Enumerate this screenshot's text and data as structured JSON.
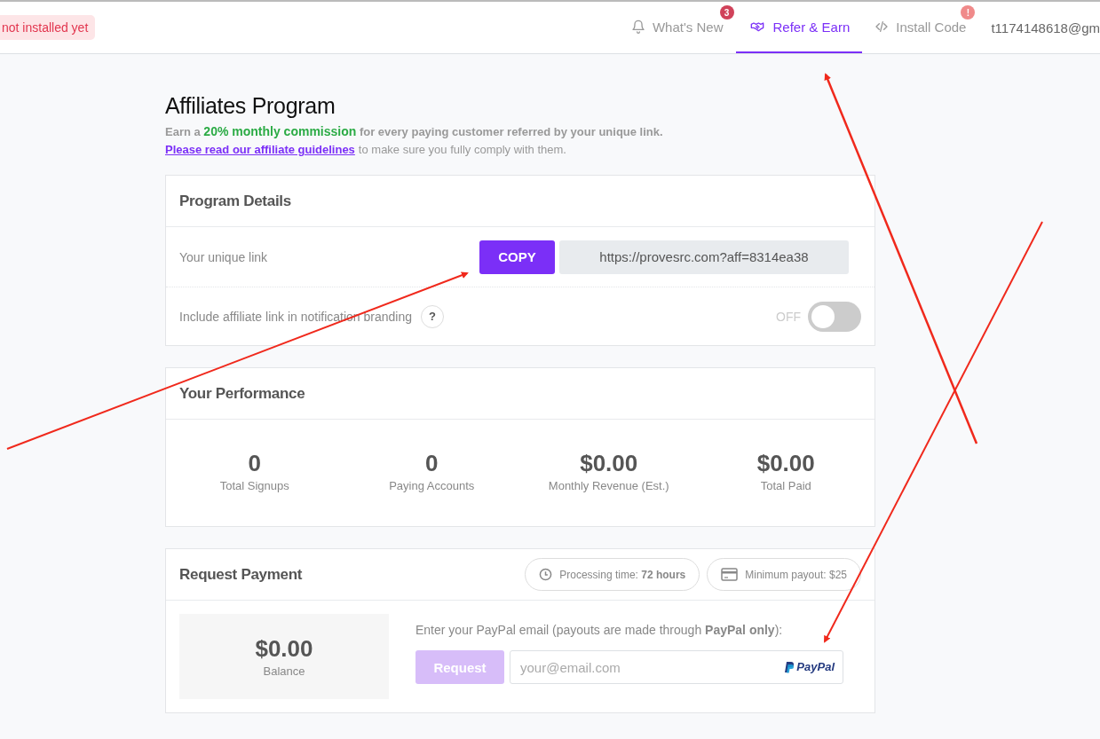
{
  "header": {
    "status_badge": "not installed yet",
    "nav": [
      {
        "kind": "bell",
        "label": "What's New",
        "selected": false,
        "badge": "3"
      },
      {
        "kind": "handshake",
        "label": "Refer & Earn",
        "selected": true
      },
      {
        "kind": "code",
        "label": "Install Code",
        "selected": false,
        "badge": "!"
      }
    ],
    "account": "t1174148618@gm"
  },
  "page": {
    "title": "Affiliates Program",
    "intro": "Earn a **20% monthly commission** for every paying customer referred by your unique link.",
    "guidelines_link": "Please read our affiliate guidelines",
    "guidelines_rest": "to make sure you fully comply with them."
  },
  "program_details": {
    "title": "Program Details",
    "link_label": "Your unique link",
    "copy_button": "COPY",
    "link": "https://provesrc.com?aff=8314ea38",
    "branding_label": "Include affiliate link in notification branding",
    "help": "?",
    "toggle_label": "OFF",
    "branding_on": false
  },
  "performance": {
    "title": "Your Performance",
    "stats": [
      {
        "value": "0",
        "label": "Total Signups"
      },
      {
        "value": "0",
        "label": "Paying Accounts"
      },
      {
        "value": "$0.00",
        "label": "Monthly Revenue (Est.)"
      },
      {
        "value": "$0.00",
        "label": "Total Paid"
      }
    ]
  },
  "payment": {
    "title": "Request Payment",
    "pills": [
      {
        "kind": "clock",
        "text": "Processing time: **72 hours**"
      },
      {
        "kind": "card",
        "text": "Minimum payout: $25"
      }
    ],
    "balance": "$0.00",
    "balance_label": "Balance",
    "email_label": "Enter your PayPal email (payouts are made through **PayPal only**):",
    "request_button": "Request",
    "request_disabled": true,
    "email_placeholder": "your@email.com",
    "paypal": "PayPal"
  }
}
